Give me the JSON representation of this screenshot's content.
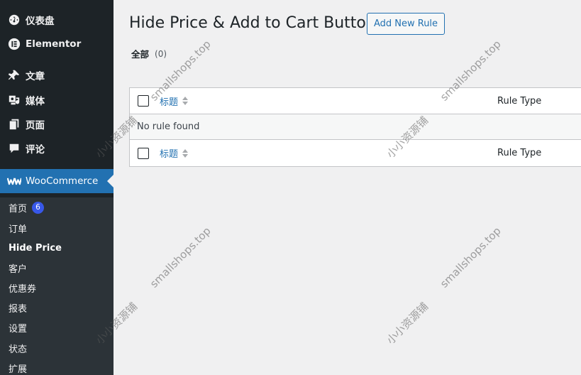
{
  "sidebar": {
    "menu": [
      {
        "label": "仪表盘",
        "icon": "dashboard-icon"
      },
      {
        "label": "Elementor",
        "icon": "elementor-icon"
      },
      {
        "label": "文章",
        "icon": "pin-icon"
      },
      {
        "label": "媒体",
        "icon": "media-icon"
      },
      {
        "label": "页面",
        "icon": "pages-icon"
      },
      {
        "label": "评论",
        "icon": "comment-icon"
      },
      {
        "label": "WooCommerce",
        "icon": "woocommerce-icon"
      }
    ],
    "submenu": [
      {
        "label": "首页",
        "badge": "6"
      },
      {
        "label": "订单"
      },
      {
        "label": "Hide Price"
      },
      {
        "label": "客户"
      },
      {
        "label": "优惠券"
      },
      {
        "label": "报表"
      },
      {
        "label": "设置"
      },
      {
        "label": "状态"
      },
      {
        "label": "扩展"
      }
    ],
    "colors": {
      "bg": "#1d2327",
      "active": "#2271b1",
      "badge": "#3858e9"
    }
  },
  "page": {
    "title": "Hide Price & Add to Cart Button",
    "add_new_label": "Add New Rule",
    "filter_label": "全部",
    "filter_count": "(0)"
  },
  "table": {
    "columns": {
      "title": "标题",
      "type": "Rule Type"
    },
    "empty_message": "No rule found"
  },
  "watermarks": [
    "smallshops.top",
    "小小资源铺"
  ]
}
